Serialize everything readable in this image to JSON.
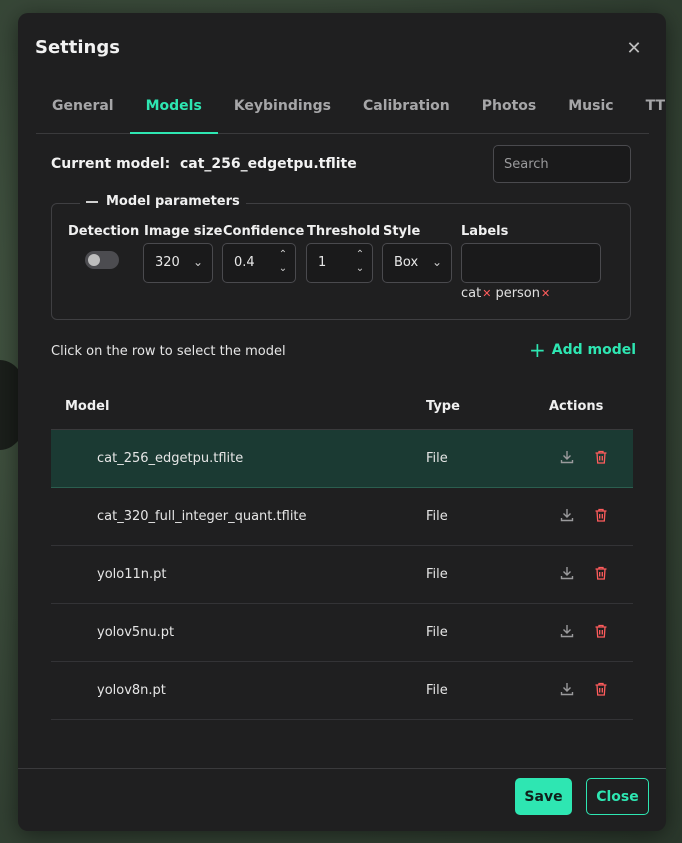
{
  "dialog": {
    "title": "Settings"
  },
  "tabs": [
    {
      "label": "General"
    },
    {
      "label": "Models",
      "active": true
    },
    {
      "label": "Keybindings"
    },
    {
      "label": "Calibration"
    },
    {
      "label": "Photos"
    },
    {
      "label": "Music"
    },
    {
      "label": "TTS"
    }
  ],
  "current_model": {
    "label": "Current model:",
    "value": "cat_256_edgetpu.tflite"
  },
  "search": {
    "placeholder": "Search"
  },
  "params": {
    "legend": "Model parameters",
    "detection": {
      "label": "Detection",
      "enabled": false
    },
    "image_size": {
      "label": "Image size",
      "value": "320"
    },
    "confidence": {
      "label": "Confidence",
      "value": "0.4"
    },
    "threshold": {
      "label": "Threshold",
      "value": "1"
    },
    "style": {
      "label": "Style",
      "value": "Box"
    },
    "labels": {
      "label": "Labels",
      "chips": [
        "cat",
        "person"
      ]
    }
  },
  "hint": "Click on the row to select the model",
  "add_model": "Add model",
  "table": {
    "headers": {
      "model": "Model",
      "type": "Type",
      "actions": "Actions"
    },
    "rows": [
      {
        "name": "cat_256_edgetpu.tflite",
        "type": "File",
        "selected": true
      },
      {
        "name": "cat_320_full_integer_quant.tflite",
        "type": "File"
      },
      {
        "name": "yolo11n.pt",
        "type": "File"
      },
      {
        "name": "yolov5nu.pt",
        "type": "File"
      },
      {
        "name": "yolov8n.pt",
        "type": "File"
      }
    ]
  },
  "footer": {
    "save": "Save",
    "close": "Close"
  },
  "colors": {
    "accent": "#2ee6b2",
    "danger": "#ff5c5c",
    "selected_row": "#1b3a33"
  }
}
